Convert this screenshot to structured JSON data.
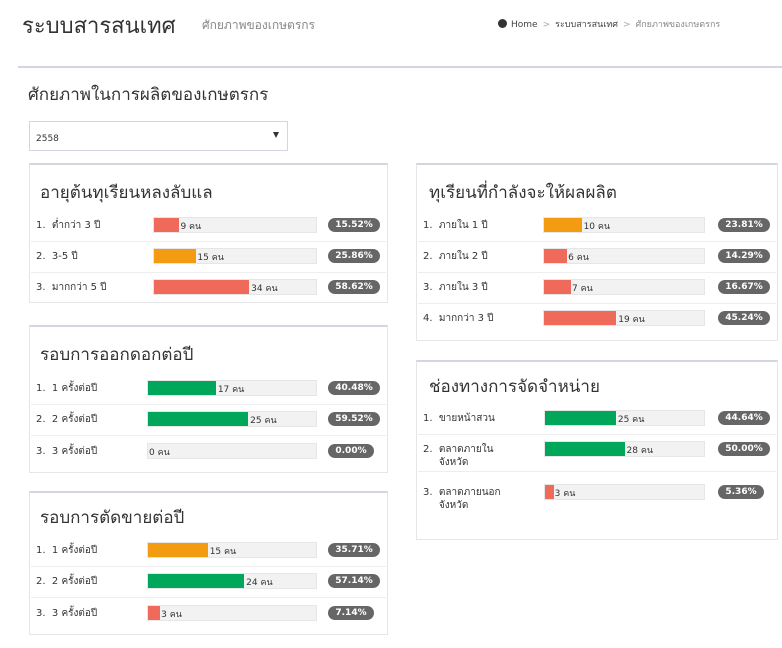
{
  "header": {
    "title": "ระบบสารสนเทศ",
    "subtitle": "ศักยภาพของเกษตรกร",
    "breadcrumb": [
      "Home",
      "ระบบสารสนเทศ",
      "ศักยภาพของเกษตรกร"
    ]
  },
  "main": {
    "title": "ศักยภาพในการผลิตของเกษตรกร",
    "year": "2558"
  },
  "colors": {
    "red": "#f06a5b",
    "orange": "#f39c12",
    "green": "#00a65a",
    "badge": "#666666"
  },
  "panels": {
    "age": {
      "title": "อายุต้นทุเรียนหลงลับแล",
      "rows": [
        {
          "label": "1.  ต่ำกว่า 3 ปี",
          "count": "9 คน",
          "pct": "15.52%",
          "fraction": 0.1552,
          "color": "red"
        },
        {
          "label": "2.  3-5 ปี",
          "count": "15 คน",
          "pct": "25.86%",
          "fraction": 0.2586,
          "color": "orange"
        },
        {
          "label": "3.  มากกว่า 5 ปี",
          "count": "34 คน",
          "pct": "58.62%",
          "fraction": 0.5862,
          "color": "red"
        }
      ]
    },
    "bloom": {
      "title": "รอบการออกดอกต่อปี",
      "rows": [
        {
          "label": "1.  1 ครั้งต่อปี",
          "count": "17 คน",
          "pct": "40.48%",
          "fraction": 0.4048,
          "color": "green"
        },
        {
          "label": "2.  2 ครั้งต่อปี",
          "count": "25 คน",
          "pct": "59.52%",
          "fraction": 0.5952,
          "color": "green"
        },
        {
          "label": "3.  3 ครั้งต่อปี",
          "count": "0 คน",
          "pct": "0.00%",
          "fraction": 0,
          "color": "green"
        }
      ]
    },
    "harvest": {
      "title": "รอบการตัดขายต่อปี",
      "rows": [
        {
          "label": "1.  1 ครั้งต่อปี",
          "count": "15 คน",
          "pct": "35.71%",
          "fraction": 0.3571,
          "color": "orange"
        },
        {
          "label": "2.  2 ครั้งต่อปี",
          "count": "24 คน",
          "pct": "57.14%",
          "fraction": 0.5714,
          "color": "green"
        },
        {
          "label": "3.  3 ครั้งต่อปี",
          "count": "3 คน",
          "pct": "7.14%",
          "fraction": 0.0714,
          "color": "red"
        }
      ]
    },
    "yielding": {
      "title": "ทุเรียนที่กำลังจะให้ผลผลิต",
      "rows": [
        {
          "label": "1.  ภายใน 1 ปี",
          "count": "10 คน",
          "pct": "23.81%",
          "fraction": 0.2381,
          "color": "orange"
        },
        {
          "label": "2.  ภายใน 2 ปี",
          "count": "6 คน",
          "pct": "14.29%",
          "fraction": 0.1429,
          "color": "red"
        },
        {
          "label": "3.  ภายใน 3 ปี",
          "count": "7 คน",
          "pct": "16.67%",
          "fraction": 0.1667,
          "color": "red"
        },
        {
          "label": "4.  มากกว่า 3 ปี",
          "count": "19 คน",
          "pct": "45.24%",
          "fraction": 0.4524,
          "color": "red"
        }
      ]
    },
    "channels": {
      "title": "ช่องทางการจัดจำหน่าย",
      "rows": [
        {
          "label": "1.  ขายหน้าสวน",
          "count": "25 คน",
          "pct": "44.64%",
          "fraction": 0.4464,
          "color": "green"
        },
        {
          "label": "2.  ตลาดภายใน\n     จังหวัด",
          "count": "28 คน",
          "pct": "50.00%",
          "fraction": 0.5,
          "color": "green"
        },
        {
          "label": "3.  ตลาดภายนอก\n     จังหวัด",
          "count": "3 คน",
          "pct": "5.36%",
          "fraction": 0.0536,
          "color": "red"
        }
      ]
    }
  }
}
